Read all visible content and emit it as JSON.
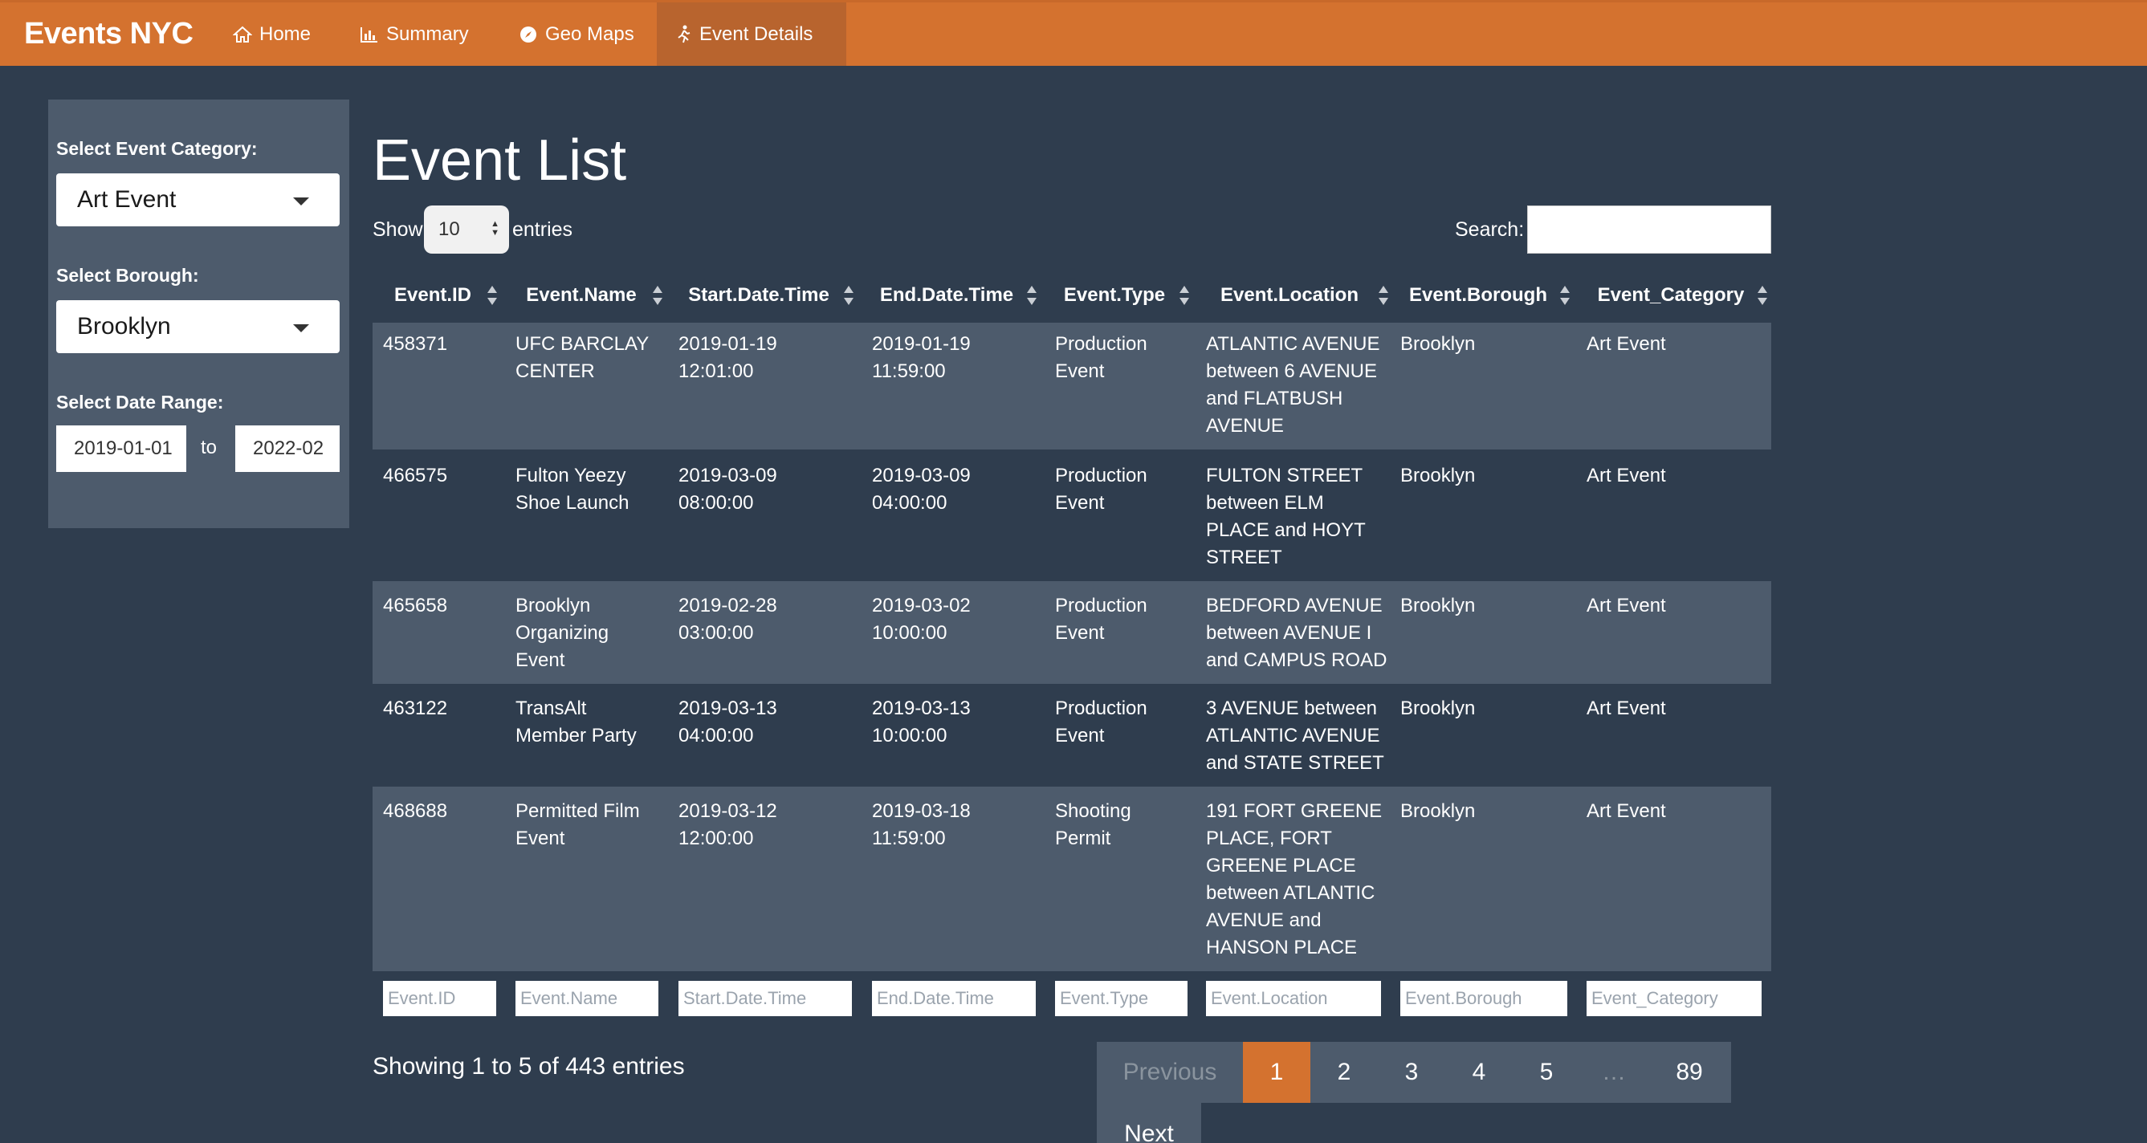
{
  "nav": {
    "brand": "Events NYC",
    "items": [
      {
        "label": "Home",
        "icon": "home-icon"
      },
      {
        "label": "Summary",
        "icon": "bar-chart-icon"
      },
      {
        "label": "Geo Maps",
        "icon": "compass-icon"
      },
      {
        "label": "Event Details",
        "icon": "running-person-icon",
        "active": true
      }
    ]
  },
  "sidebar": {
    "category_label": "Select Event Category:",
    "category_value": "Art Event",
    "borough_label": "Select Borough:",
    "borough_value": "Brooklyn",
    "date_label": "Select Date Range:",
    "date_start": "2019-01-01",
    "date_to": "to",
    "date_end": "2022-02"
  },
  "main": {
    "title": "Event List",
    "show_label": "Show",
    "page_length": "10",
    "entries_label": "entries",
    "search_label": "Search:",
    "search_value": ""
  },
  "table": {
    "columns": [
      "Event.ID",
      "Event.Name",
      "Start.Date.Time",
      "End.Date.Time",
      "Event.Type",
      "Event.Location",
      "Event.Borough",
      "Event_Category"
    ],
    "rows": [
      {
        "id": "458371",
        "name": [
          "UFC BARCLAY",
          "CENTER"
        ],
        "start": [
          "2019-01-19",
          "12:01:00"
        ],
        "end": [
          "2019-01-19",
          "11:59:00"
        ],
        "type": [
          "Production",
          "Event"
        ],
        "location": [
          "ATLANTIC AVENUE",
          "between 6 AVENUE",
          "and FLATBUSH",
          "AVENUE"
        ],
        "borough": "Brooklyn",
        "category": "Art Event"
      },
      {
        "id": "466575",
        "name": [
          "Fulton Yeezy",
          "Shoe Launch"
        ],
        "start": [
          "2019-03-09",
          "08:00:00"
        ],
        "end": [
          "2019-03-09",
          "04:00:00"
        ],
        "type": [
          "Production",
          "Event"
        ],
        "location": [
          "FULTON STREET",
          "between ELM",
          "PLACE and HOYT",
          "STREET"
        ],
        "borough": "Brooklyn",
        "category": "Art Event"
      },
      {
        "id": "465658",
        "name": [
          "Brooklyn",
          "Organizing",
          "Event"
        ],
        "start": [
          "2019-02-28",
          "03:00:00"
        ],
        "end": [
          "2019-03-02",
          "10:00:00"
        ],
        "type": [
          "Production",
          "Event"
        ],
        "location": [
          "BEDFORD AVENUE",
          "between AVENUE I",
          "and CAMPUS ROAD"
        ],
        "borough": "Brooklyn",
        "category": "Art Event"
      },
      {
        "id": "463122",
        "name": [
          "TransAlt",
          "Member Party"
        ],
        "start": [
          "2019-03-13",
          "04:00:00"
        ],
        "end": [
          "2019-03-13",
          "10:00:00"
        ],
        "type": [
          "Production",
          "Event"
        ],
        "location": [
          "3 AVENUE between",
          "ATLANTIC AVENUE",
          "and STATE STREET"
        ],
        "borough": "Brooklyn",
        "category": "Art Event"
      },
      {
        "id": "468688",
        "name": [
          "Permitted Film",
          "Event"
        ],
        "start": [
          "2019-03-12",
          "12:00:00"
        ],
        "end": [
          "2019-03-18",
          "11:59:00"
        ],
        "type": [
          "Shooting",
          "Permit"
        ],
        "location": [
          "191 FORT GREENE",
          "PLACE, FORT",
          "GREENE PLACE",
          "between ATLANTIC",
          "AVENUE and",
          "HANSON PLACE"
        ],
        "borough": "Brooklyn",
        "category": "Art Event"
      }
    ],
    "filter_placeholders": [
      "Event.ID",
      "Event.Name",
      "Start.Date.Time",
      "End.Date.Time",
      "Event.Type",
      "Event.Location",
      "Event.Borough",
      "Event_Category"
    ]
  },
  "footer": {
    "info": "Showing 1 to 5 of 443 entries",
    "pagination": {
      "previous": "Previous",
      "pages": [
        "1",
        "2",
        "3",
        "4",
        "5",
        "…",
        "89"
      ],
      "current": "1",
      "next": "Next"
    }
  },
  "colors": {
    "navbar": "#d4722f",
    "background": "#2f3d4e",
    "panel": "#4d5b6c",
    "active_page": "#d4722f"
  }
}
